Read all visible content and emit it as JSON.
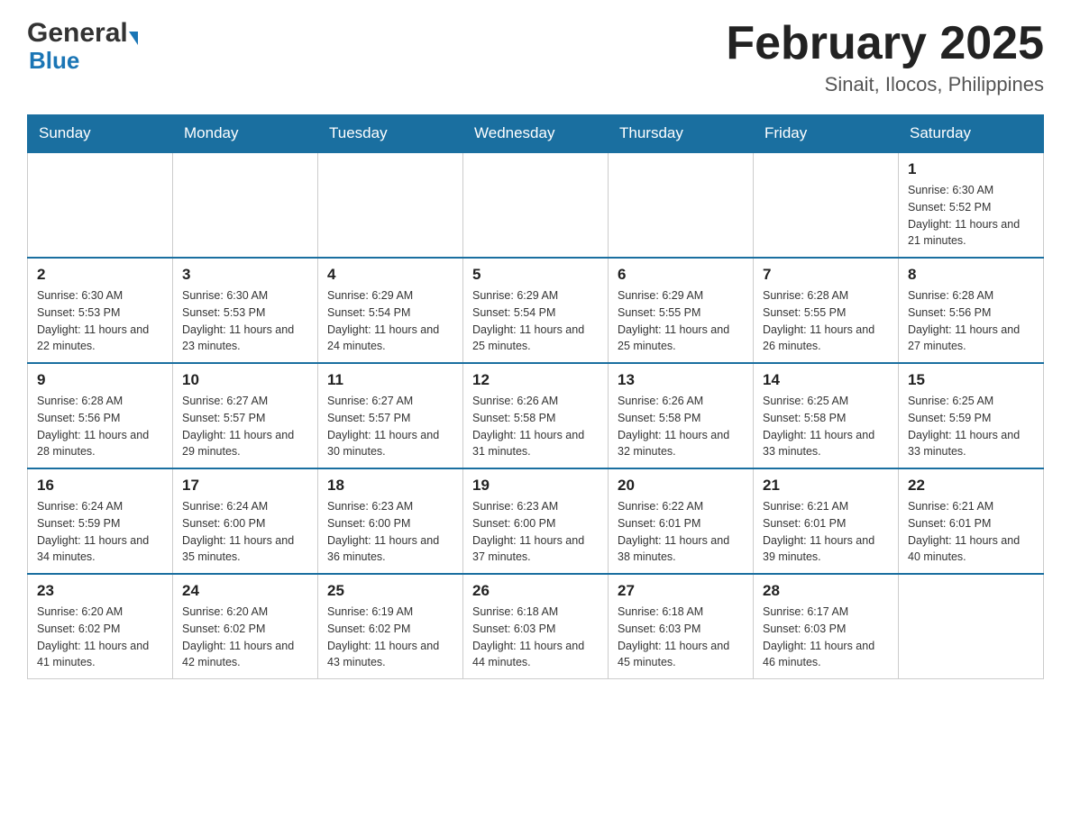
{
  "header": {
    "logo_general": "General",
    "logo_blue": "Blue",
    "title": "February 2025",
    "subtitle": "Sinait, Ilocos, Philippines"
  },
  "weekdays": [
    "Sunday",
    "Monday",
    "Tuesday",
    "Wednesday",
    "Thursday",
    "Friday",
    "Saturday"
  ],
  "weeks": [
    [
      {
        "day": "",
        "info": ""
      },
      {
        "day": "",
        "info": ""
      },
      {
        "day": "",
        "info": ""
      },
      {
        "day": "",
        "info": ""
      },
      {
        "day": "",
        "info": ""
      },
      {
        "day": "",
        "info": ""
      },
      {
        "day": "1",
        "info": "Sunrise: 6:30 AM\nSunset: 5:52 PM\nDaylight: 11 hours\nand 21 minutes."
      }
    ],
    [
      {
        "day": "2",
        "info": "Sunrise: 6:30 AM\nSunset: 5:53 PM\nDaylight: 11 hours\nand 22 minutes."
      },
      {
        "day": "3",
        "info": "Sunrise: 6:30 AM\nSunset: 5:53 PM\nDaylight: 11 hours\nand 23 minutes."
      },
      {
        "day": "4",
        "info": "Sunrise: 6:29 AM\nSunset: 5:54 PM\nDaylight: 11 hours\nand 24 minutes."
      },
      {
        "day": "5",
        "info": "Sunrise: 6:29 AM\nSunset: 5:54 PM\nDaylight: 11 hours\nand 25 minutes."
      },
      {
        "day": "6",
        "info": "Sunrise: 6:29 AM\nSunset: 5:55 PM\nDaylight: 11 hours\nand 25 minutes."
      },
      {
        "day": "7",
        "info": "Sunrise: 6:28 AM\nSunset: 5:55 PM\nDaylight: 11 hours\nand 26 minutes."
      },
      {
        "day": "8",
        "info": "Sunrise: 6:28 AM\nSunset: 5:56 PM\nDaylight: 11 hours\nand 27 minutes."
      }
    ],
    [
      {
        "day": "9",
        "info": "Sunrise: 6:28 AM\nSunset: 5:56 PM\nDaylight: 11 hours\nand 28 minutes."
      },
      {
        "day": "10",
        "info": "Sunrise: 6:27 AM\nSunset: 5:57 PM\nDaylight: 11 hours\nand 29 minutes."
      },
      {
        "day": "11",
        "info": "Sunrise: 6:27 AM\nSunset: 5:57 PM\nDaylight: 11 hours\nand 30 minutes."
      },
      {
        "day": "12",
        "info": "Sunrise: 6:26 AM\nSunset: 5:58 PM\nDaylight: 11 hours\nand 31 minutes."
      },
      {
        "day": "13",
        "info": "Sunrise: 6:26 AM\nSunset: 5:58 PM\nDaylight: 11 hours\nand 32 minutes."
      },
      {
        "day": "14",
        "info": "Sunrise: 6:25 AM\nSunset: 5:58 PM\nDaylight: 11 hours\nand 33 minutes."
      },
      {
        "day": "15",
        "info": "Sunrise: 6:25 AM\nSunset: 5:59 PM\nDaylight: 11 hours\nand 33 minutes."
      }
    ],
    [
      {
        "day": "16",
        "info": "Sunrise: 6:24 AM\nSunset: 5:59 PM\nDaylight: 11 hours\nand 34 minutes."
      },
      {
        "day": "17",
        "info": "Sunrise: 6:24 AM\nSunset: 6:00 PM\nDaylight: 11 hours\nand 35 minutes."
      },
      {
        "day": "18",
        "info": "Sunrise: 6:23 AM\nSunset: 6:00 PM\nDaylight: 11 hours\nand 36 minutes."
      },
      {
        "day": "19",
        "info": "Sunrise: 6:23 AM\nSunset: 6:00 PM\nDaylight: 11 hours\nand 37 minutes."
      },
      {
        "day": "20",
        "info": "Sunrise: 6:22 AM\nSunset: 6:01 PM\nDaylight: 11 hours\nand 38 minutes."
      },
      {
        "day": "21",
        "info": "Sunrise: 6:21 AM\nSunset: 6:01 PM\nDaylight: 11 hours\nand 39 minutes."
      },
      {
        "day": "22",
        "info": "Sunrise: 6:21 AM\nSunset: 6:01 PM\nDaylight: 11 hours\nand 40 minutes."
      }
    ],
    [
      {
        "day": "23",
        "info": "Sunrise: 6:20 AM\nSunset: 6:02 PM\nDaylight: 11 hours\nand 41 minutes."
      },
      {
        "day": "24",
        "info": "Sunrise: 6:20 AM\nSunset: 6:02 PM\nDaylight: 11 hours\nand 42 minutes."
      },
      {
        "day": "25",
        "info": "Sunrise: 6:19 AM\nSunset: 6:02 PM\nDaylight: 11 hours\nand 43 minutes."
      },
      {
        "day": "26",
        "info": "Sunrise: 6:18 AM\nSunset: 6:03 PM\nDaylight: 11 hours\nand 44 minutes."
      },
      {
        "day": "27",
        "info": "Sunrise: 6:18 AM\nSunset: 6:03 PM\nDaylight: 11 hours\nand 45 minutes."
      },
      {
        "day": "28",
        "info": "Sunrise: 6:17 AM\nSunset: 6:03 PM\nDaylight: 11 hours\nand 46 minutes."
      },
      {
        "day": "",
        "info": ""
      }
    ]
  ]
}
